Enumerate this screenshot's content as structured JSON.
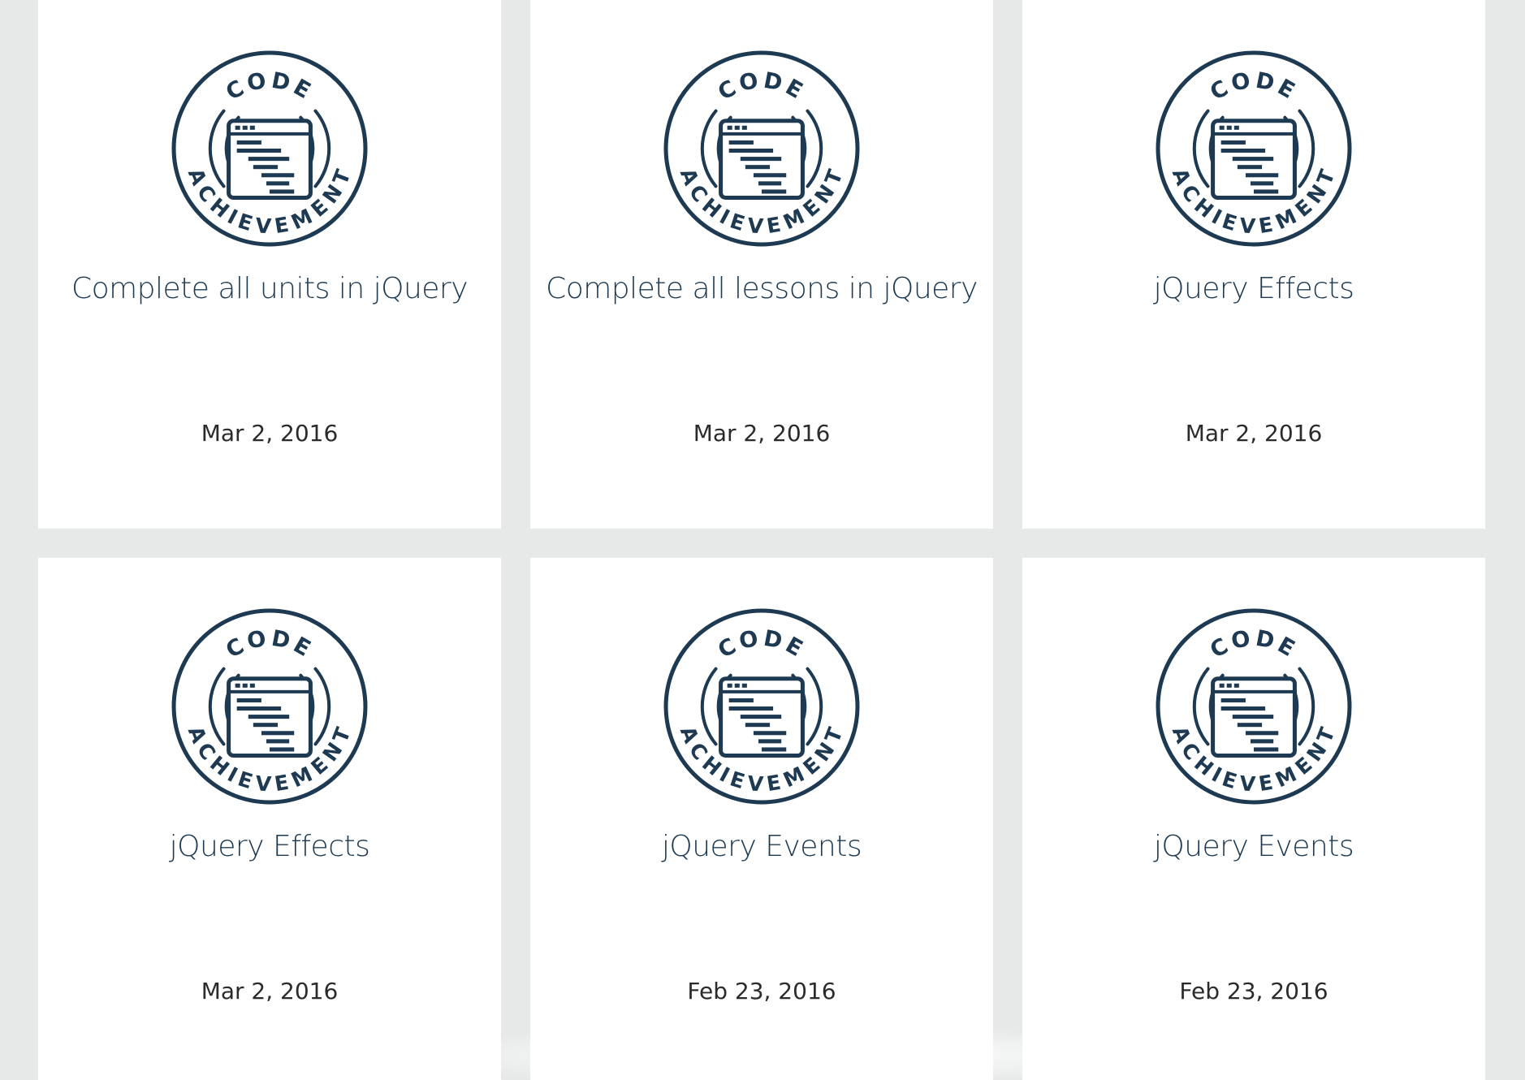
{
  "badge": {
    "top_text": "CODE",
    "bottom_text": "ACHIEVEMENT",
    "color": "#1d3a52"
  },
  "cards": [
    {
      "title": "Complete all units in jQuery",
      "date": "Mar 2, 2016"
    },
    {
      "title": "Complete all lessons in jQuery",
      "date": "Mar 2, 2016"
    },
    {
      "title": "jQuery Effects",
      "date": "Mar 2, 2016"
    },
    {
      "title": "jQuery Effects",
      "date": "Mar 2, 2016"
    },
    {
      "title": "jQuery Events",
      "date": "Feb 23, 2016"
    },
    {
      "title": "jQuery Events",
      "date": "Feb 23, 2016"
    }
  ]
}
